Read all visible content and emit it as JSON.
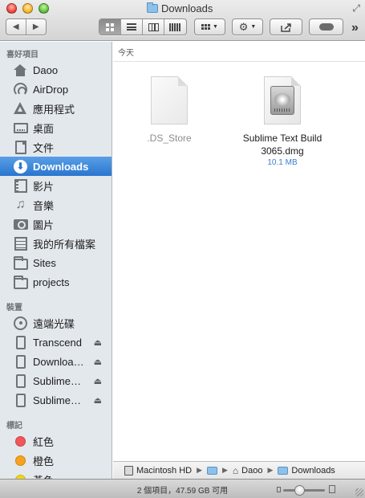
{
  "window": {
    "title": "Downloads"
  },
  "toolbar": {
    "back_icon": "chevron-left-icon",
    "forward_icon": "chevron-right-icon",
    "view_modes": [
      "icon-view",
      "list-view",
      "column-view",
      "cover-flow-view"
    ],
    "active_view": "icon-view",
    "arrange_icon": "grid-arrange-icon",
    "action_icon": "gear-icon",
    "share_icon": "share-icon",
    "tag_icon": "tag-toggle-icon",
    "overflow_label": "»"
  },
  "sidebar": {
    "favorites_heading": "喜好項目",
    "favorites": [
      {
        "label": "Daoo",
        "icon": "home-icon"
      },
      {
        "label": "AirDrop",
        "icon": "airdrop-icon"
      },
      {
        "label": "應用程式",
        "icon": "applications-icon"
      },
      {
        "label": "桌面",
        "icon": "desktop-icon"
      },
      {
        "label": "文件",
        "icon": "documents-icon"
      },
      {
        "label": "Downloads",
        "icon": "downloads-icon",
        "selected": true
      },
      {
        "label": "影片",
        "icon": "movies-icon"
      },
      {
        "label": "音樂",
        "icon": "music-icon"
      },
      {
        "label": "圖片",
        "icon": "pictures-icon"
      },
      {
        "label": "我的所有檔案",
        "icon": "all-files-icon"
      },
      {
        "label": "Sites",
        "icon": "folder-icon"
      },
      {
        "label": "projects",
        "icon": "folder-icon"
      }
    ],
    "devices_heading": "裝置",
    "devices": [
      {
        "label": "遠端光碟",
        "icon": "remote-disc-icon"
      },
      {
        "label": "Transcend",
        "icon": "drive-icon",
        "eject": true
      },
      {
        "label": "Downloa…",
        "icon": "drive-icon",
        "eject": true
      },
      {
        "label": "Sublime…",
        "icon": "drive-icon",
        "eject": true
      },
      {
        "label": "Sublime…",
        "icon": "drive-icon",
        "eject": true
      }
    ],
    "tags_heading": "標記",
    "tags": [
      {
        "label": "紅色",
        "color": "#f0575a"
      },
      {
        "label": "橙色",
        "color": "#f7a31d"
      },
      {
        "label": "黃色",
        "color": "#f3d51c"
      }
    ],
    "accent_color": "#2a76cf"
  },
  "main": {
    "group_header": "今天",
    "files": [
      {
        "name": ".DS_Store",
        "size": "",
        "icon": "blank-document-icon",
        "dimmed": true
      },
      {
        "name": "Sublime Text Build 3065.dmg",
        "size": "10.1 MB",
        "icon": "disk-image-icon",
        "dimmed": false
      }
    ]
  },
  "path_bar": {
    "segments": [
      {
        "label": "Macintosh HD",
        "icon": "hard-drive-icon"
      },
      {
        "label": "",
        "icon": "users-folder-icon"
      },
      {
        "label": "Daoo",
        "icon": "home-icon"
      },
      {
        "label": "Downloads",
        "icon": "downloads-folder-icon"
      }
    ]
  },
  "status_bar": {
    "text": "2 個項目，47.59 GB 可用",
    "icon_size_level": 0.35
  }
}
